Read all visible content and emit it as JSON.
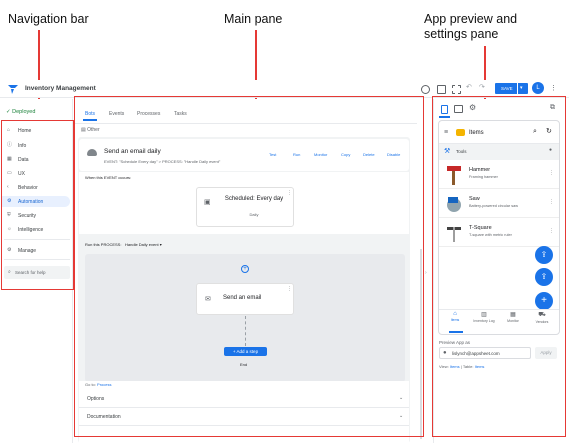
{
  "callouts": {
    "navigation": "Navigation bar",
    "main": "Main pane",
    "preview": "App preview and\nsettings pane"
  },
  "app": {
    "name": "Inventory Management",
    "save_label": "SAVE",
    "avatar_letter": "L"
  },
  "sidebar": {
    "status": "Deployed",
    "items": [
      {
        "label": "Home",
        "icon": "home-icon"
      },
      {
        "label": "Info",
        "icon": "info-icon"
      },
      {
        "label": "Data",
        "icon": "table-icon"
      },
      {
        "label": "UX",
        "icon": "layout-icon"
      },
      {
        "label": "Behavior",
        "icon": "behavior-icon"
      },
      {
        "label": "Automation",
        "icon": "automation-icon"
      },
      {
        "label": "Security",
        "icon": "shield-icon"
      },
      {
        "label": "Intelligence",
        "icon": "lightbulb-icon"
      },
      {
        "label": "Manage",
        "icon": "gear-icon"
      }
    ],
    "selected": "Automation",
    "search_placeholder": "Search for help"
  },
  "main": {
    "tabs": [
      "Bots",
      "Events",
      "Processes",
      "Tasks"
    ],
    "selected_tab": "Bots",
    "other": "Other",
    "bot": {
      "title": "Send an email daily",
      "subtitle": "EVENT: \"Schedule Every day\" > PROCESS: \"Handle Daily event\"",
      "actions": [
        "Test",
        "Run",
        "Monitor",
        "Copy",
        "Delete",
        "Disable"
      ]
    },
    "event_label": "When this EVENT occurs:",
    "event_card": {
      "title": "Scheduled: Every day",
      "sub": "Daily"
    },
    "process_label": "Run this PROCESS:",
    "process_name": "Handle Daily event",
    "step_card": {
      "title": "Send an email"
    },
    "add_step": "+ Add a step",
    "end": "End",
    "go_to": "Go to:",
    "go_to_link": "Process",
    "options": "Options",
    "documentation": "Documentation"
  },
  "preview": {
    "header": "Items",
    "group": "Tools",
    "items": [
      {
        "title": "Hammer",
        "sub": "Framing hammer"
      },
      {
        "title": "Saw",
        "sub": "Battery-powered circular saw"
      },
      {
        "title": "T-Square",
        "sub": "T-square with metric ruler"
      }
    ],
    "bottom_tabs": [
      "Items",
      "Inventory Log",
      "Monitor",
      "Vendors"
    ],
    "preview_as": "Preview App as",
    "email": "lislynch@appsheet.com",
    "apply": "Apply",
    "view_label": "View:",
    "view_value": "Items",
    "table_label": "Table:",
    "table_value": "Items"
  }
}
